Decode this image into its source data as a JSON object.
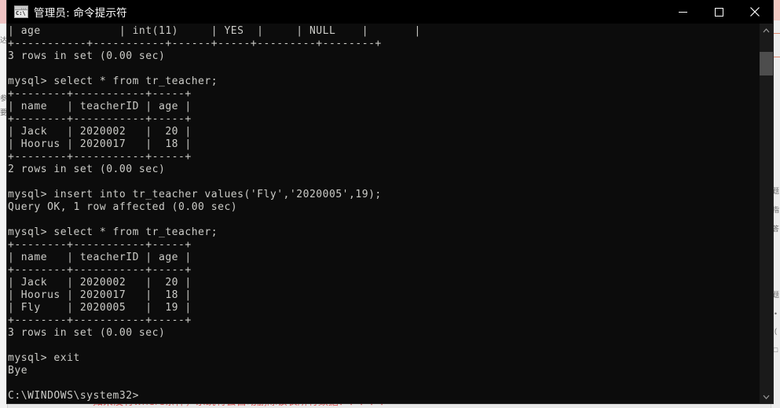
{
  "window": {
    "title": "管理员: 命令提示符",
    "icon": "command-prompt-icon",
    "prompt_glyph": "C:\\",
    "controls": {
      "minimize": "—",
      "maximize": "□",
      "close": "✕"
    }
  },
  "terminal": {
    "lines": [
      "| age            | int(11)     | YES  |     | NULL    |       |",
      "+-----------+-----------+------+-----+---------+--------+",
      "3 rows in set (0.00 sec)",
      "",
      "mysql> select * from tr_teacher;",
      "+--------+-----------+-----+",
      "| name   | teacherID | age |",
      "+--------+-----------+-----+",
      "| Jack   | 2020002   |  20 |",
      "| Hoorus | 2020017   |  18 |",
      "+--------+-----------+-----+",
      "2 rows in set (0.00 sec)",
      "",
      "mysql> insert into tr_teacher values('Fly','2020005',19);",
      "Query OK, 1 row affected (0.00 sec)",
      "",
      "mysql> select * from tr_teacher;",
      "+--------+-----------+-----+",
      "| name   | teacherID | age |",
      "+--------+-----------+-----+",
      "| Jack   | 2020002   |  20 |",
      "| Hoorus | 2020017   |  18 |",
      "| Fly    | 2020005   |  19 |",
      "+--------+-----------+-----+",
      "3 rows in set (0.00 sec)",
      "",
      "mysql> exit",
      "Bye",
      "",
      "C:\\WINDOWS\\system32>"
    ],
    "foreground_color": "#ccccc8",
    "background_color": "#0c0c0c"
  },
  "scrollbar": {
    "up_arrow": "ⱏ",
    "down_arrow": "ⱟ",
    "thumb_label": "scroll-thumb"
  },
  "background": {
    "bottom_note": "如果没有where条件，系统将会自动删除该表所有数据！！！！！",
    "left_glyphs": [
      "达",
      "参",
      "要"
    ],
    "right_glyphs": [
      "题",
      "指",
      "答",
      "题",
      "•",
      "(",
      "□"
    ]
  }
}
